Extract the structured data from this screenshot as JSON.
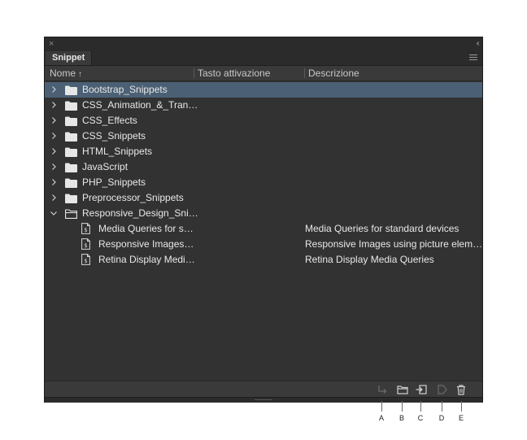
{
  "panel": {
    "close_glyph": "×",
    "collapse_glyph": "‹‹",
    "tab_label": "Snippet"
  },
  "columns": {
    "name": "Nome",
    "name_sort_glyph": "↑",
    "hotkey": "Tasto attivazione",
    "description": "Descrizione"
  },
  "rows": [
    {
      "name": "Bootstrap_Snippets",
      "type": "folder",
      "expanded": false,
      "selected": true,
      "description": ""
    },
    {
      "name": "CSS_Animation_&_Tran…",
      "type": "folder",
      "expanded": false,
      "description": ""
    },
    {
      "name": "CSS_Effects",
      "type": "folder",
      "expanded": false,
      "description": ""
    },
    {
      "name": "CSS_Snippets",
      "type": "folder",
      "expanded": false,
      "description": ""
    },
    {
      "name": "HTML_Snippets",
      "type": "folder",
      "expanded": false,
      "description": ""
    },
    {
      "name": "JavaScript",
      "type": "folder",
      "expanded": false,
      "description": ""
    },
    {
      "name": "PHP_Snippets",
      "type": "folder",
      "expanded": false,
      "description": ""
    },
    {
      "name": "Preprocessor_Snippets",
      "type": "folder",
      "expanded": false,
      "description": ""
    },
    {
      "name": "Responsive_Design_Sni…",
      "type": "folder",
      "expanded": true,
      "description": ""
    },
    {
      "name": "Media Queries for s…",
      "type": "file",
      "description": "Media Queries for standard devices"
    },
    {
      "name": "Responsive Images…",
      "type": "file",
      "description": "Responsive Images using picture elem…"
    },
    {
      "name": "Retina Display Medi…",
      "type": "file",
      "description": "Retina Display Media Queries"
    }
  ],
  "toolbar": {
    "icons": [
      "insert-icon",
      "new-folder-icon",
      "new-snippet-icon",
      "edit-snippet-icon",
      "trash-icon"
    ]
  },
  "callouts": [
    "A",
    "B",
    "C",
    "D",
    "E"
  ],
  "colors": {
    "panel_bg": "#323232",
    "selection": "#4b6075",
    "text": "#e8e8e8"
  }
}
